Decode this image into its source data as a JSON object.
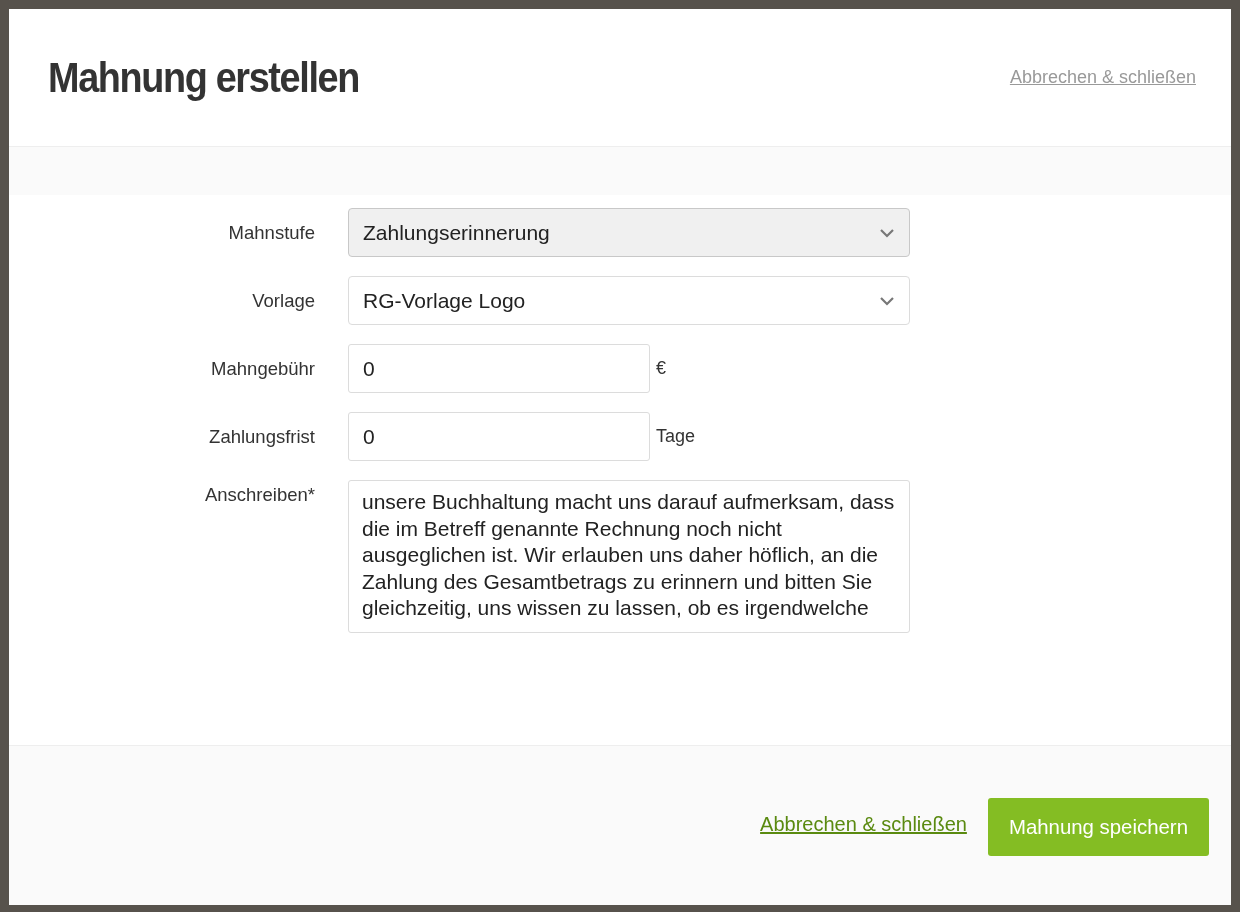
{
  "dialog": {
    "title": "Mahnung erstellen",
    "header_link": "Abbrechen & schließen"
  },
  "fields": [
    {
      "kind": "select",
      "label": "Mahnstufe",
      "value": "Zahlungserinnerung",
      "active": true
    },
    {
      "kind": "select",
      "label": "Vorlage",
      "value": "RG-Vorlage Logo",
      "active": false
    },
    {
      "kind": "input",
      "label": "Mahngebühr",
      "value": "0",
      "unit": "€"
    },
    {
      "kind": "input",
      "label": "Zahlungsfrist",
      "value": "0",
      "unit": "Tage"
    },
    {
      "kind": "textarea",
      "label": "Anschreiben*",
      "value": "unsere Buchhaltung macht uns darauf aufmerksam, dass die im Betreff genannte Rechnung noch nicht ausgeglichen ist. Wir erlauben uns daher höflich, an die Zahlung des Gesamtbetrags zu erinnern und bitten Sie gleichzeitig, uns wissen zu lassen, ob es irgendwelche"
    }
  ],
  "footer": {
    "cancel_link": "Abbrechen & schließen",
    "save_button": "Mahnung speichern"
  }
}
